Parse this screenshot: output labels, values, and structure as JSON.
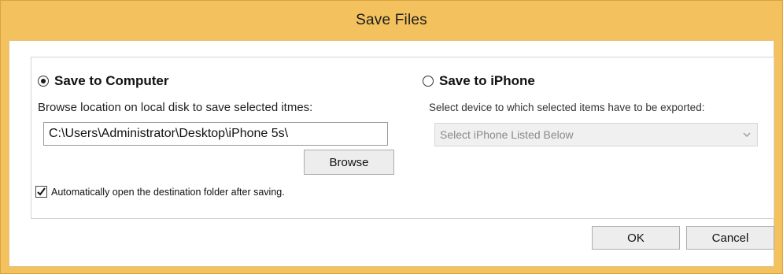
{
  "window": {
    "title": "Save Files"
  },
  "save_to_computer": {
    "radio_label": "Save to Computer",
    "selected": true,
    "hint": "Browse location on local disk to save selected itmes:",
    "path_value": "C:\\Users\\Administrator\\Desktop\\iPhone 5s\\",
    "browse_label": "Browse",
    "auto_open_label": "Automatically open the destination folder after saving.",
    "auto_open_checked": true
  },
  "save_to_iphone": {
    "radio_label": "Save to iPhone",
    "selected": false,
    "hint": "Select device to which selected items have to be exported:",
    "device_select_value": "Select iPhone Listed Below"
  },
  "footer": {
    "ok_label": "OK",
    "cancel_label": "Cancel"
  },
  "icons": {
    "checkmark": "checkmark-icon",
    "dropdown": "chevron-down-icon"
  },
  "colors": {
    "window_frame": "#f3c25e",
    "client_background": "#ffffff"
  }
}
